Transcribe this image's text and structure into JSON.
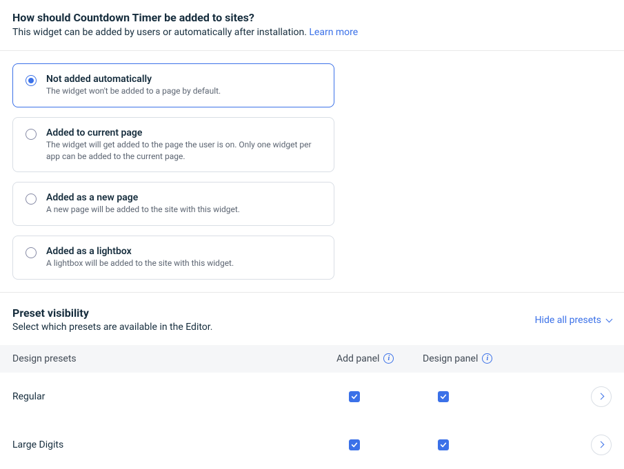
{
  "header": {
    "title": "How should Countdown Timer be added to sites?",
    "subtitle": "This widget can be added by users or automatically after installation.",
    "learn_more": "Learn more"
  },
  "options": [
    {
      "title": "Not added automatically",
      "desc": "The widget won't be added to a page by default.",
      "selected": true
    },
    {
      "title": "Added to current page",
      "desc": "The widget will get added to the page the user is on. Only one widget per app can be added to the current page.",
      "selected": false
    },
    {
      "title": "Added as a new page",
      "desc": "A new page will be added to the site with this widget.",
      "selected": false
    },
    {
      "title": "Added as a lightbox",
      "desc": "A lightbox will be added to the site with this widget.",
      "selected": false
    }
  ],
  "preset": {
    "title": "Preset visibility",
    "subtitle": "Select which presets are available in the Editor.",
    "hide_all": "Hide all presets"
  },
  "table": {
    "col1": "Design presets",
    "col2": "Add panel",
    "col3": "Design panel",
    "rows": [
      {
        "name": "Regular",
        "add": true,
        "design": true
      },
      {
        "name": "Large Digits",
        "add": true,
        "design": true
      }
    ]
  }
}
